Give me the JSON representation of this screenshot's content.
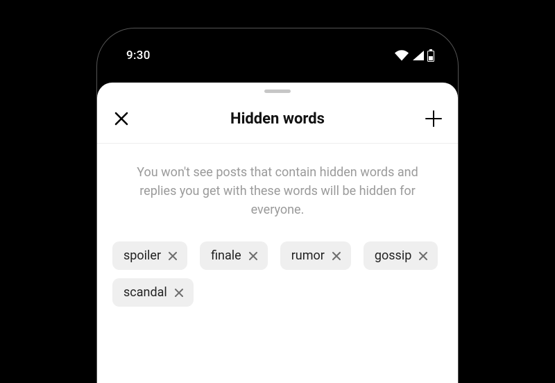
{
  "status": {
    "time": "9:30"
  },
  "header": {
    "title": "Hidden words"
  },
  "description": "You won't see posts that contain hidden words and replies you get with these words will be hidden for everyone.",
  "chips": [
    {
      "label": "spoiler"
    },
    {
      "label": "finale"
    },
    {
      "label": "rumor"
    },
    {
      "label": "gossip"
    },
    {
      "label": "scandal"
    }
  ]
}
